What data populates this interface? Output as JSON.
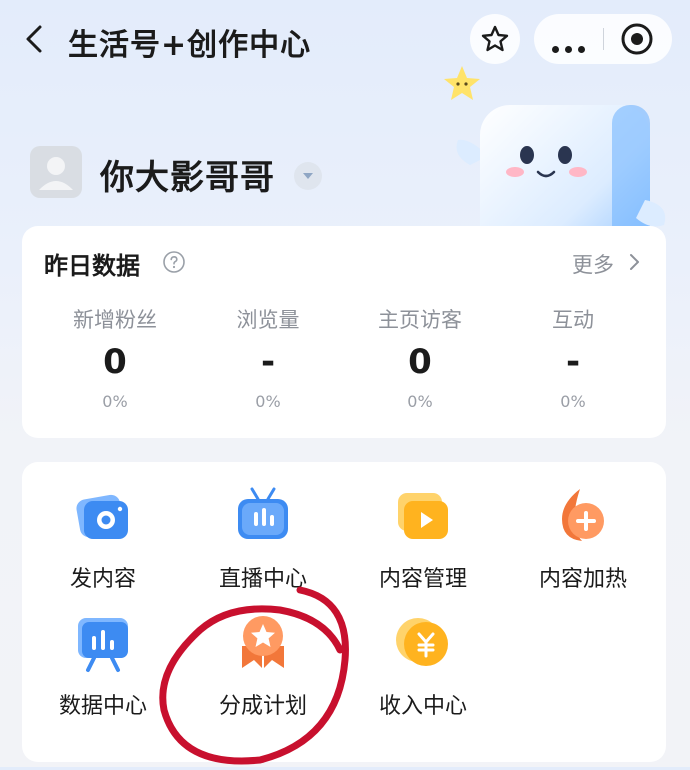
{
  "header": {
    "title": "生活号+创作中心",
    "back_icon": "chevron-left-icon",
    "favorite_icon": "star-icon",
    "more_icon": "more-dots-icon",
    "close_icon": "target-icon"
  },
  "profile": {
    "name": "你大影哥哥",
    "avatar_icon": "user-avatar-icon",
    "switch_icon": "caret-down-icon"
  },
  "stats": {
    "title": "昨日数据",
    "more_label": "更多",
    "items": [
      {
        "label": "新增粉丝",
        "value": "0",
        "change": "0%"
      },
      {
        "label": "浏览量",
        "value": "-",
        "change": "0%"
      },
      {
        "label": "主页访客",
        "value": "0",
        "change": "0%"
      },
      {
        "label": "互动",
        "value": "-",
        "change": "0%"
      }
    ]
  },
  "tools": {
    "items": [
      {
        "label": "发内容",
        "icon": "camera-icon"
      },
      {
        "label": "直播中心",
        "icon": "live-tv-icon"
      },
      {
        "label": "内容管理",
        "icon": "video-folder-icon"
      },
      {
        "label": "内容加热",
        "icon": "flame-plus-icon"
      },
      {
        "label": "数据中心",
        "icon": "chart-board-icon"
      },
      {
        "label": "分成计划",
        "icon": "star-medal-icon"
      },
      {
        "label": "收入中心",
        "icon": "yuan-coin-icon"
      }
    ]
  },
  "colors": {
    "accent_blue": "#3d8bf2",
    "accent_orange": "#f2773a",
    "annotation_red": "#c8102e"
  }
}
